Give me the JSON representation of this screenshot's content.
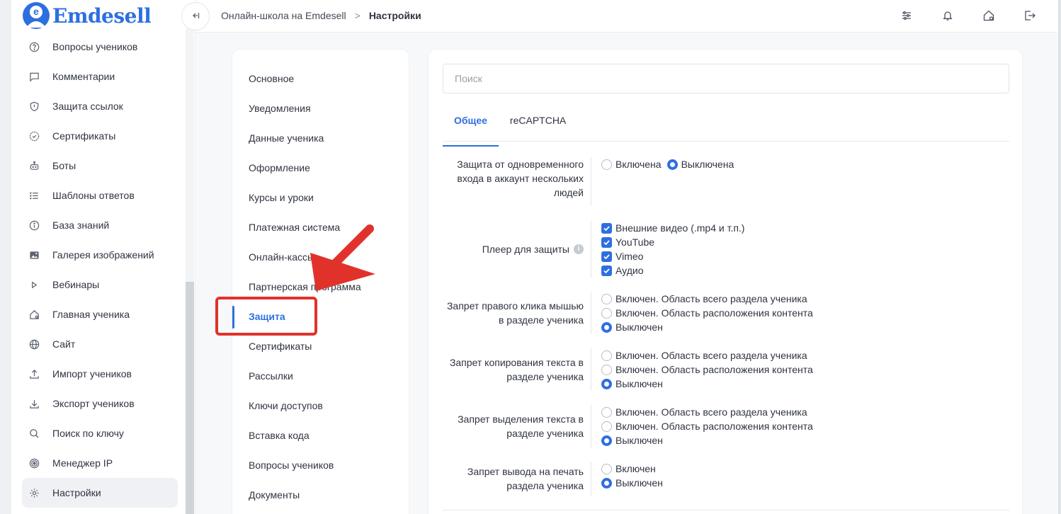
{
  "brand": {
    "logo_text": "Emdesell",
    "logo_letter": "e"
  },
  "sidebar": {
    "items": [
      {
        "label": "Вопросы учеников",
        "icon": "question-circle-icon"
      },
      {
        "label": "Комментарии",
        "icon": "comment-icon"
      },
      {
        "label": "Защита ссылок",
        "icon": "shield-icon"
      },
      {
        "label": "Сертификаты",
        "icon": "certificate-icon"
      },
      {
        "label": "Боты",
        "icon": "bot-icon"
      },
      {
        "label": "Шаблоны ответов",
        "icon": "list-icon"
      },
      {
        "label": "База знаний",
        "icon": "info-icon"
      },
      {
        "label": "Галерея изображений",
        "icon": "image-icon"
      },
      {
        "label": "Вебинары",
        "icon": "play-icon"
      },
      {
        "label": "Главная ученика",
        "icon": "home-icon"
      },
      {
        "label": "Сайт",
        "icon": "globe-icon"
      },
      {
        "label": "Импорт учеников",
        "icon": "upload-icon"
      },
      {
        "label": "Экспорт учеников",
        "icon": "download-icon"
      },
      {
        "label": "Поиск по ключу",
        "icon": "search-icon"
      },
      {
        "label": "Менеджер IP",
        "icon": "target-icon"
      },
      {
        "label": "Настройки",
        "icon": "gear-icon",
        "active": true
      }
    ]
  },
  "breadcrumb": {
    "parent": "Онлайн-школа на Emdesell",
    "separator": ">",
    "current": "Настройки"
  },
  "settings_menu": {
    "items": [
      "Основное",
      "Уведомления",
      "Данные ученика",
      "Оформление",
      "Курсы и уроки",
      "Платежная система",
      "Онлайн-кассы",
      "Партнерская программа",
      "Защита",
      "Сертификаты",
      "Рассылки",
      "Ключи доступов",
      "Вставка кода",
      "Вопросы учеников",
      "Документы"
    ],
    "active": "Защита"
  },
  "content": {
    "search_placeholder": "Поиск",
    "tabs": [
      "Общее",
      "reCAPTCHA"
    ],
    "active_tab": "Общее",
    "rows": [
      {
        "label": "Защита от одновременного входа в аккаунт нескольких людей",
        "type": "radio-inline",
        "options": [
          {
            "label": "Включена",
            "checked": false
          },
          {
            "label": "Выключена",
            "checked": true
          }
        ]
      },
      {
        "label": "Плеер для защиты",
        "info": "i",
        "type": "checkbox",
        "options": [
          {
            "label": "Внешние видео (.mp4 и т.п.)",
            "checked": true
          },
          {
            "label": "YouTube",
            "checked": true
          },
          {
            "label": "Vimeo",
            "checked": true
          },
          {
            "label": "Аудио",
            "checked": true
          }
        ]
      },
      {
        "label": "Запрет правого клика мышью в разделе ученика",
        "type": "radio",
        "options": [
          {
            "label": "Включен. Область всего раздела ученика",
            "checked": false
          },
          {
            "label": "Включен. Область расположения контента",
            "checked": false
          },
          {
            "label": "Выключен",
            "checked": true
          }
        ]
      },
      {
        "label": "Запрет копирования текста в разделе ученика",
        "type": "radio",
        "options": [
          {
            "label": "Включен. Область всего раздела ученика",
            "checked": false
          },
          {
            "label": "Включен. Область расположения контента",
            "checked": false
          },
          {
            "label": "Выключен",
            "checked": true
          }
        ]
      },
      {
        "label": "Запрет выделения текста в разделе ученика",
        "type": "radio",
        "options": [
          {
            "label": "Включен. Область всего раздела ученика",
            "checked": false
          },
          {
            "label": "Включен. Область расположения контента",
            "checked": false
          },
          {
            "label": "Выключен",
            "checked": true
          }
        ]
      },
      {
        "label": "Запрет вывода на печать раздела ученика",
        "type": "radio",
        "options": [
          {
            "label": "Включен",
            "checked": false
          },
          {
            "label": "Выключен",
            "checked": true
          }
        ]
      }
    ]
  },
  "colors": {
    "accent": "#2e6fe0",
    "annotation_red": "#e0322a",
    "text": "#2f3441"
  }
}
